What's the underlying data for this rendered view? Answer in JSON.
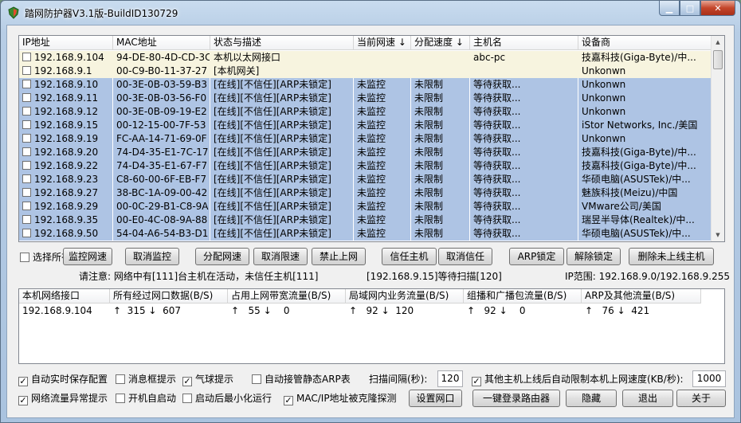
{
  "window": {
    "title": "踏网防护器V3.1版-BuildID130729"
  },
  "hosts_table": {
    "columns": [
      "IP地址",
      "MAC地址",
      "状态与描述",
      "当前网速 ↓",
      "分配速度 ↓",
      "主机名",
      "设备商"
    ],
    "rows": [
      {
        "ip": "192.168.9.104",
        "mac": "94-DE-80-4D-CD-3C",
        "status": "本机以太网接口",
        "speed": "",
        "limit": "",
        "host": "abc-pc",
        "vendor": "技嘉科技(Giga-Byte)/中...",
        "style": "hl"
      },
      {
        "ip": "192.168.9.1",
        "mac": "00-C9-B0-11-37-27",
        "status": "[本机网关]",
        "speed": "",
        "limit": "",
        "host": "",
        "vendor": "Unkonwn",
        "style": "hl"
      },
      {
        "ip": "192.168.9.10",
        "mac": "00-3E-0B-03-59-B3",
        "status": "[在线][不信任][ARP未锁定]",
        "speed": "未监控",
        "limit": "未限制",
        "host": "等待获取...",
        "vendor": "Unkonwn",
        "style": "off"
      },
      {
        "ip": "192.168.9.11",
        "mac": "00-3E-0B-03-56-F0",
        "status": "[在线][不信任][ARP未锁定]",
        "speed": "未监控",
        "limit": "未限制",
        "host": "等待获取...",
        "vendor": "Unkonwn",
        "style": "off"
      },
      {
        "ip": "192.168.9.12",
        "mac": "00-3E-0B-09-19-E2",
        "status": "[在线][不信任][ARP未锁定]",
        "speed": "未监控",
        "limit": "未限制",
        "host": "等待获取...",
        "vendor": "Unkonwn",
        "style": "off"
      },
      {
        "ip": "192.168.9.15",
        "mac": "00-12-15-00-7F-53",
        "status": "[在线][不信任][ARP未锁定]",
        "speed": "未监控",
        "limit": "未限制",
        "host": "等待获取...",
        "vendor": "iStor Networks, Inc./美国",
        "style": "off"
      },
      {
        "ip": "192.168.9.19",
        "mac": "FC-AA-14-71-69-0F",
        "status": "[在线][不信任][ARP未锁定]",
        "speed": "未监控",
        "limit": "未限制",
        "host": "等待获取...",
        "vendor": "Unkonwn",
        "style": "off"
      },
      {
        "ip": "192.168.9.20",
        "mac": "74-D4-35-E1-7C-17",
        "status": "[在线][不信任][ARP未锁定]",
        "speed": "未监控",
        "limit": "未限制",
        "host": "等待获取...",
        "vendor": "技嘉科技(Giga-Byte)/中...",
        "style": "off"
      },
      {
        "ip": "192.168.9.22",
        "mac": "74-D4-35-E1-67-F7",
        "status": "[在线][不信任][ARP未锁定]",
        "speed": "未监控",
        "limit": "未限制",
        "host": "等待获取...",
        "vendor": "技嘉科技(Giga-Byte)/中...",
        "style": "off"
      },
      {
        "ip": "192.168.9.23",
        "mac": "C8-60-00-6F-EB-F7",
        "status": "[在线][不信任][ARP未锁定]",
        "speed": "未监控",
        "limit": "未限制",
        "host": "等待获取...",
        "vendor": "华硕电脑(ASUSTek)/中...",
        "style": "off"
      },
      {
        "ip": "192.168.9.27",
        "mac": "38-BC-1A-09-00-42",
        "status": "[在线][不信任][ARP未锁定]",
        "speed": "未监控",
        "limit": "未限制",
        "host": "等待获取...",
        "vendor": "魅族科技(Meizu)/中国",
        "style": "off"
      },
      {
        "ip": "192.168.9.29",
        "mac": "00-0C-29-B1-C8-9A",
        "status": "[在线][不信任][ARP未锁定]",
        "speed": "未监控",
        "limit": "未限制",
        "host": "等待获取...",
        "vendor": "VMware公司/美国",
        "style": "off"
      },
      {
        "ip": "192.168.9.35",
        "mac": "00-E0-4C-08-9A-88",
        "status": "[在线][不信任][ARP未锁定]",
        "speed": "未监控",
        "limit": "未限制",
        "host": "等待获取...",
        "vendor": "瑞昱半导体(Realtek)/中...",
        "style": "off"
      },
      {
        "ip": "192.168.9.50",
        "mac": "54-04-A6-54-B3-D1",
        "status": "[在线][不信任][ARP未锁定]",
        "speed": "未监控",
        "limit": "未限制",
        "host": "等待获取...",
        "vendor": "华硕电脑(ASUSTek)/中...",
        "style": "off"
      }
    ]
  },
  "toolbar": {
    "select_all": "选择所有",
    "buttons": [
      "监控网速",
      "取消监控",
      "分配网速",
      "取消限速",
      "禁止上网",
      "信任主机",
      "取消信任",
      "ARP锁定",
      "解除锁定",
      "删除未上线主机"
    ]
  },
  "status": {
    "notice": "请注意: 网络中有[111]台主机在活动，未信任主机[111]",
    "scan": "[192.168.9.15]等待扫描[120]",
    "ip_range": "IP范围: 192.168.9.0/192.168.9.255"
  },
  "traffic_table": {
    "columns": [
      "本机网络接口",
      "所有经过网口数据(B/S)",
      "占用上网带宽流量(B/S)",
      "局域网内业务流量(B/S)",
      "组播和广播包流量(B/S)",
      "ARP及其他流量(B/S)"
    ],
    "row": [
      "192.168.9.104",
      "↑  315 ↓  607",
      "↑   55 ↓    0",
      "↑   92 ↓  120",
      "↑   92 ↓    0",
      "↑   76 ↓  421"
    ]
  },
  "options": {
    "auto_save": "自动实时保存配置",
    "msgbox": "消息框提示",
    "balloon": "气球提示",
    "static_arp": "自动接管静态ARP表",
    "scan_label": "扫描间隔(秒):",
    "scan_value": "120",
    "auto_limit": "其他主机上线后自动限制本机上网速度(KB/秒):",
    "auto_limit_value": "1000",
    "traffic_alert": "网络流量异常提示",
    "autostart": "开机自启动",
    "start_min": "启动后最小化运行",
    "clone_detect": "MAC/IP地址被克隆探测"
  },
  "bottom_buttons": {
    "set_port": "设置网口",
    "login_router": "一键登录路由器",
    "hide": "隐藏",
    "exit": "退出",
    "about": "关于"
  }
}
